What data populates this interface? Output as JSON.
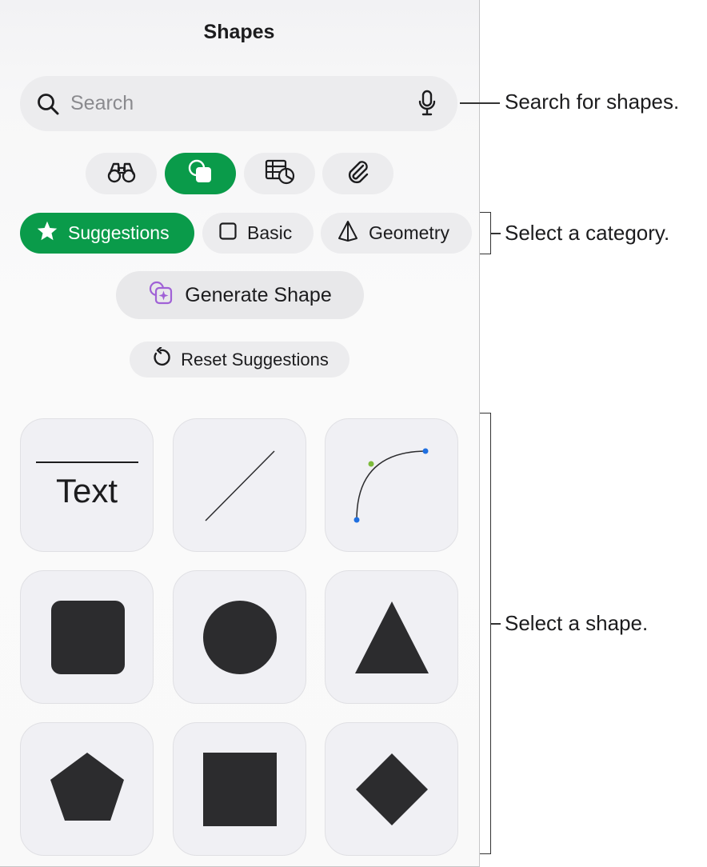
{
  "header": {
    "title": "Shapes"
  },
  "search": {
    "placeholder": "Search"
  },
  "icon_tabs": [
    {
      "icon": "binoculars-icon",
      "active": false
    },
    {
      "icon": "shapes-icon",
      "active": true
    },
    {
      "icon": "table-chart-icon",
      "active": false
    },
    {
      "icon": "paperclip-icon",
      "active": false
    }
  ],
  "categories": [
    {
      "label": "Suggestions",
      "icon": "star-icon",
      "active": true
    },
    {
      "label": "Basic",
      "icon": "square-outline-icon",
      "active": false
    },
    {
      "label": "Geometry",
      "icon": "pyramid-icon",
      "active": false
    }
  ],
  "actions": {
    "generate_label": "Generate Shape",
    "reset_label": "Reset Suggestions"
  },
  "shapes": [
    {
      "name": "text",
      "label": "Text"
    },
    {
      "name": "line"
    },
    {
      "name": "curve"
    },
    {
      "name": "rounded-square"
    },
    {
      "name": "circle"
    },
    {
      "name": "triangle"
    },
    {
      "name": "pentagon"
    },
    {
      "name": "square"
    },
    {
      "name": "diamond"
    }
  ],
  "callouts": {
    "search": "Search for shapes.",
    "category": "Select a category.",
    "shape": "Select a shape."
  },
  "colors": {
    "accent": "#0a9b4a",
    "shape_fill": "#2c2c2e",
    "curve_start_handle": "#7dbb3c",
    "curve_end_handle": "#1f6fe0"
  }
}
